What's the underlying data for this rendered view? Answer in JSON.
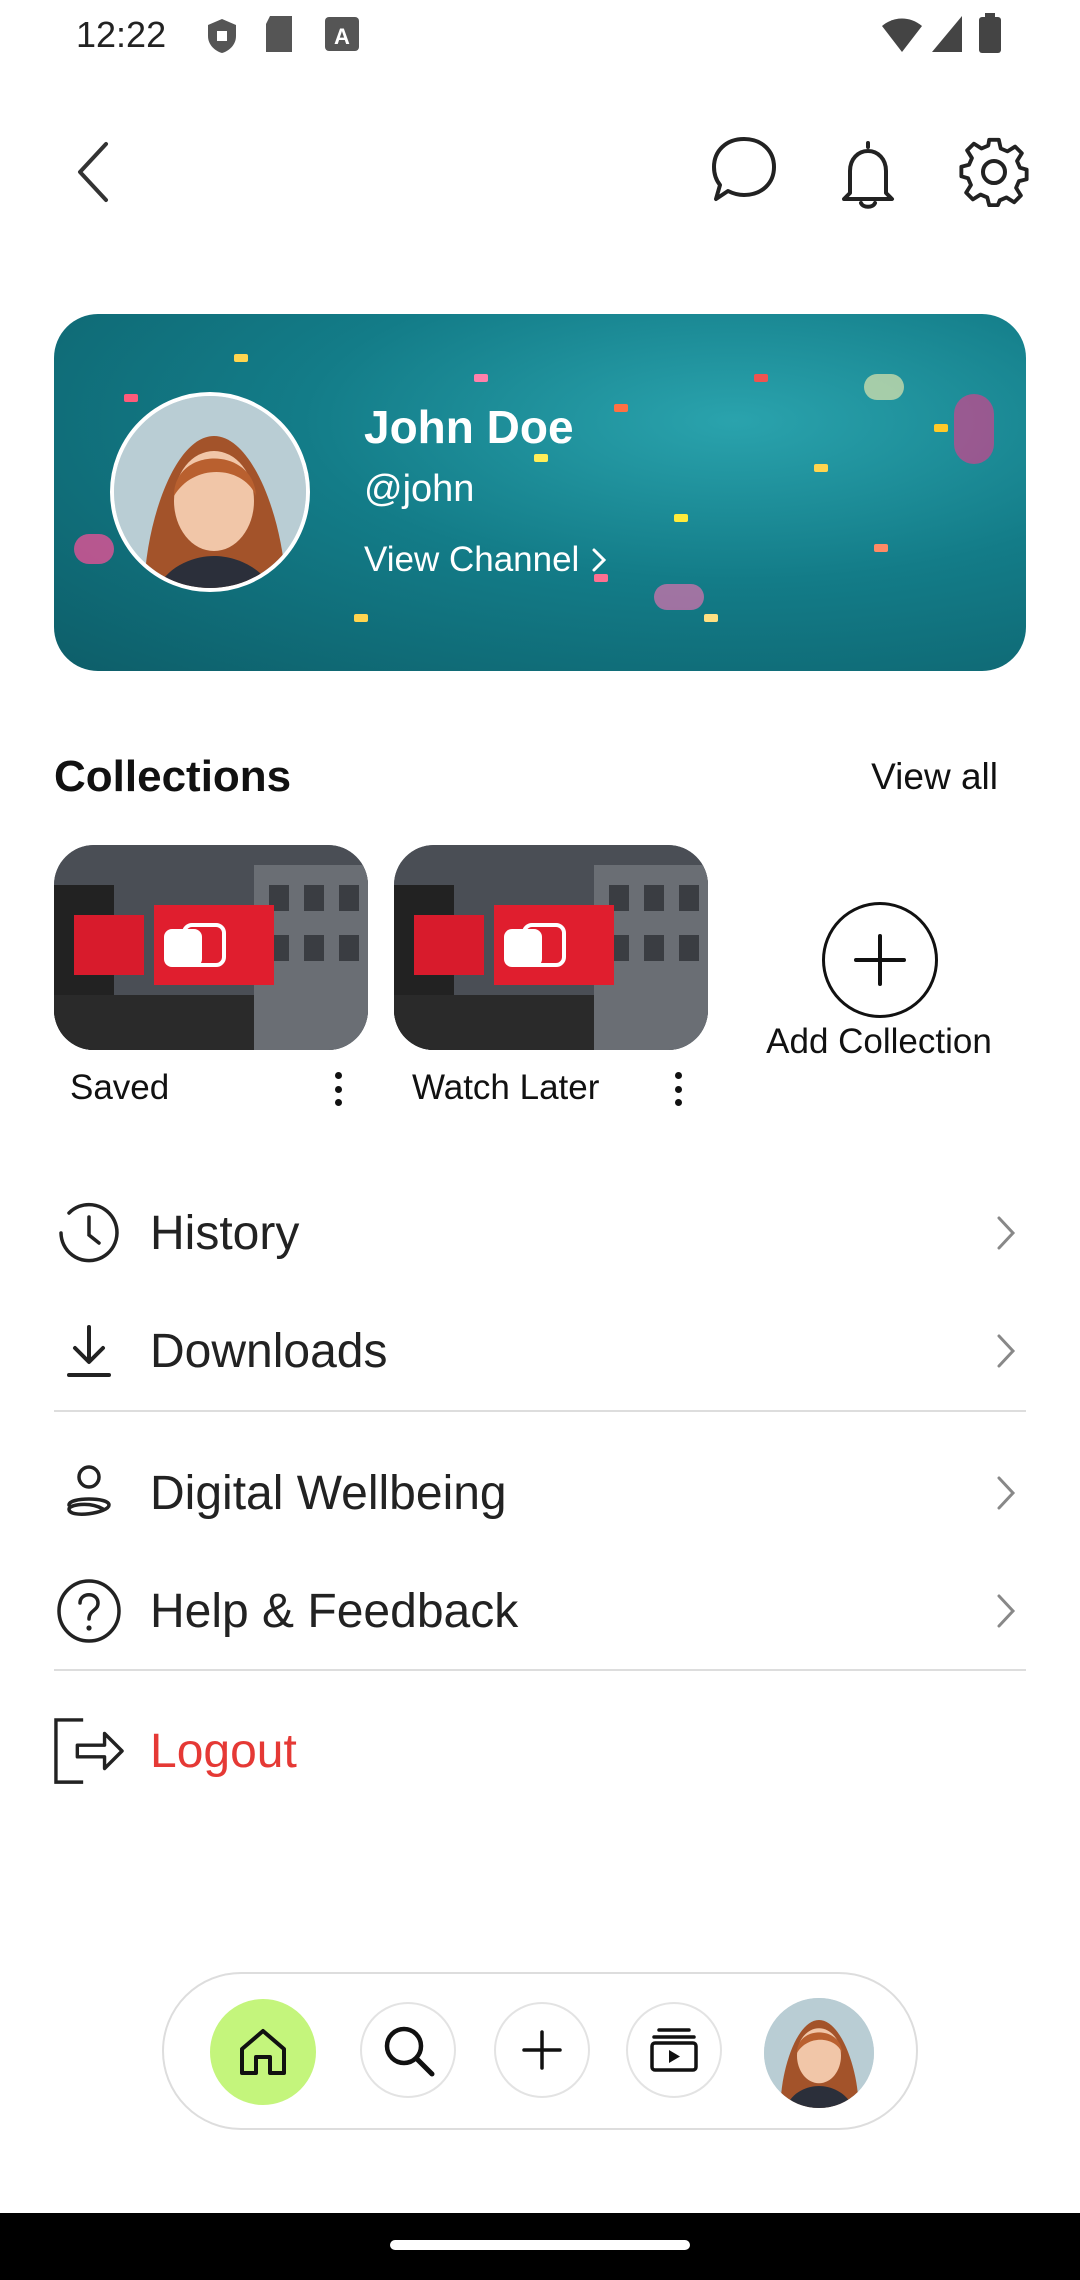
{
  "status_bar": {
    "time": "12:22"
  },
  "profile": {
    "name": "John Doe",
    "handle": "@john",
    "view_channel": "View Channel"
  },
  "collections": {
    "title": "Collections",
    "view_all": "View all",
    "items": [
      {
        "label": "Saved"
      },
      {
        "label": "Watch Later"
      }
    ],
    "add_label": "Add Collection"
  },
  "menu": {
    "history": "History",
    "downloads": "Downloads",
    "wellbeing": "Digital Wellbeing",
    "help": "Help & Feedback",
    "logout": "Logout"
  },
  "colors": {
    "accent_green": "#c4f57c",
    "logout_red": "#e53935",
    "card_teal": "#137c88"
  }
}
